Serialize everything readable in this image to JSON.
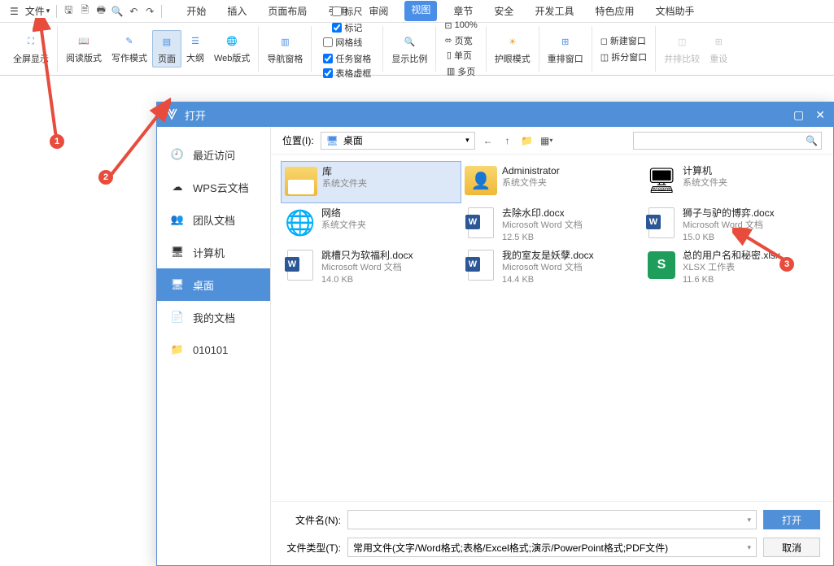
{
  "menu": {
    "file": "文件"
  },
  "tabs": [
    "开始",
    "插入",
    "页面布局",
    "引用",
    "审阅",
    "视图",
    "章节",
    "安全",
    "开发工具",
    "特色应用",
    "文档助手"
  ],
  "active_tab": 5,
  "ribbon": {
    "fullscreen": "全屏显示",
    "read": "阅读版式",
    "write": "写作模式",
    "page": "页面",
    "outline": "大纲",
    "web": "Web版式",
    "navpane": "导航窗格",
    "ruler": "标尺",
    "gridlines": "网格线",
    "markup": "标记",
    "tablevr": "表格虚框",
    "taskpane": "任务窗格",
    "zoomratio": "显示比例",
    "zoom100": "100%",
    "pagewidth": "页宽",
    "singlepage": "单页",
    "multipage": "多页",
    "eyecare": "护眼模式",
    "rearrange": "重排窗口",
    "newwin": "新建窗口",
    "splitwin": "拆分窗口",
    "sidebyside": "并排比较",
    "reset": "重设"
  },
  "dialog": {
    "title": "打开",
    "side": [
      "最近访问",
      "WPS云文档",
      "团队文档",
      "计算机",
      "桌面",
      "我的文档",
      "010101"
    ],
    "active_side": 4,
    "location_label": "位置(I):",
    "location_value": "桌面",
    "files": [
      {
        "name": "库",
        "meta": "系统文件夹",
        "size": "",
        "type": "lib",
        "selected": true
      },
      {
        "name": "Administrator",
        "meta": "系统文件夹",
        "size": "",
        "type": "user"
      },
      {
        "name": "计算机",
        "meta": "系统文件夹",
        "size": "",
        "type": "pc"
      },
      {
        "name": "网络",
        "meta": "系统文件夹",
        "size": "",
        "type": "net"
      },
      {
        "name": "去除水印.docx",
        "meta": "Microsoft Word 文档",
        "size": "12.5 KB",
        "type": "docx"
      },
      {
        "name": "狮子与驴的博弈.docx",
        "meta": "Microsoft Word 文档",
        "size": "15.0 KB",
        "type": "docx"
      },
      {
        "name": "跳槽只为软福利.docx",
        "meta": "Microsoft Word 文档",
        "size": "14.0 KB",
        "type": "docx"
      },
      {
        "name": "我的室友是妖孽.docx",
        "meta": "Microsoft Word 文档",
        "size": "14.4 KB",
        "type": "docx"
      },
      {
        "name": "总的用户名和秘密.xlsx",
        "meta": "XLSX 工作表",
        "size": "11.6 KB",
        "type": "xlsx"
      }
    ],
    "filename_label": "文件名(N):",
    "filetype_label": "文件类型(T):",
    "filetype_value": "常用文件(文字/Word格式;表格/Excel格式;演示/PowerPoint格式;PDF文件)",
    "open_btn": "打开",
    "cancel_btn": "取消"
  },
  "annotations": {
    "n1": "1",
    "n2": "2",
    "n3": "3"
  }
}
